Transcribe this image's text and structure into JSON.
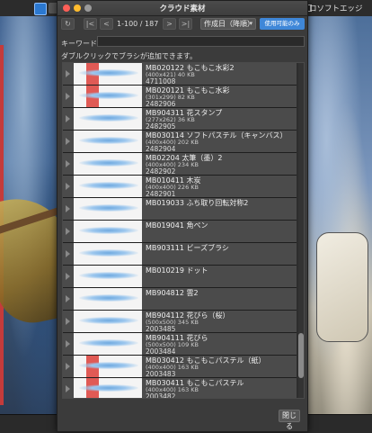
{
  "background": {
    "right_label": "ロソフトエッジ"
  },
  "dialog": {
    "title": "クラウド素材",
    "toolbar": {
      "reload_icon": "↻",
      "first_icon": "|<",
      "prev_icon": "<",
      "next_icon": ">",
      "last_icon": ">|",
      "count": "1-100 / 187",
      "sort_value": "作成日（降順）",
      "filter_label": "使用可能のみ"
    },
    "keyword_label": "キーワード:",
    "keyword_value": "",
    "hint": "ダブルクリックでブラシが追加できます。",
    "close_label": "閉じる"
  },
  "items": [
    {
      "name": "MB020122 もこもこ水彩2",
      "size": "(400x421) 40 KB",
      "id": "4711008",
      "thumb": "red"
    },
    {
      "name": "MB020121 もこもこ水彩",
      "size": "(301x299) 82 KB",
      "id": "2482906",
      "thumb": "red"
    },
    {
      "name": "MB904311 花スタンプ",
      "size": "(277x262) 36 KB",
      "id": "2482905",
      "thumb": "dots"
    },
    {
      "name": "MB030114 ソフトパステル（キャンバス）",
      "size": "(400x400) 202 KB",
      "id": "2482904",
      "thumb": "stroke"
    },
    {
      "name": "MB02204 太筆（墨）2",
      "size": "(400x400) 234 KB",
      "id": "2482902",
      "thumb": "stroke"
    },
    {
      "name": "MB010411 木炭",
      "size": "(400x400) 226 KB",
      "id": "2482901",
      "thumb": "stroke"
    },
    {
      "name": "MB019033 ふち取り回転対称2",
      "size": "",
      "id": "",
      "thumb": "pattern"
    },
    {
      "name": "MB019041 角ペン",
      "size": "",
      "id": "",
      "thumb": "wave"
    },
    {
      "name": "MB903111 ビーズブラシ",
      "size": "",
      "id": "",
      "thumb": "beads"
    },
    {
      "name": "MB010219 ドット",
      "size": "",
      "id": "",
      "thumb": "dot"
    },
    {
      "name": "MB904812 雲2",
      "size": "",
      "id": "",
      "thumb": "cloud"
    },
    {
      "name": "MB904112 花びら（桜）",
      "size": "(500x500) 345 KB",
      "id": "2003485",
      "thumb": "petal"
    },
    {
      "name": "MB904111 花びら",
      "size": "(500x500) 109 KB",
      "id": "2003484",
      "thumb": "petal"
    },
    {
      "name": "MB030412 もこもこパステル（紙）",
      "size": "(400x400) 163 KB",
      "id": "2003483",
      "thumb": "red"
    },
    {
      "name": "MB030411 もこもこパステル",
      "size": "(400x400) 163 KB",
      "id": "2003482",
      "thumb": "red"
    }
  ]
}
